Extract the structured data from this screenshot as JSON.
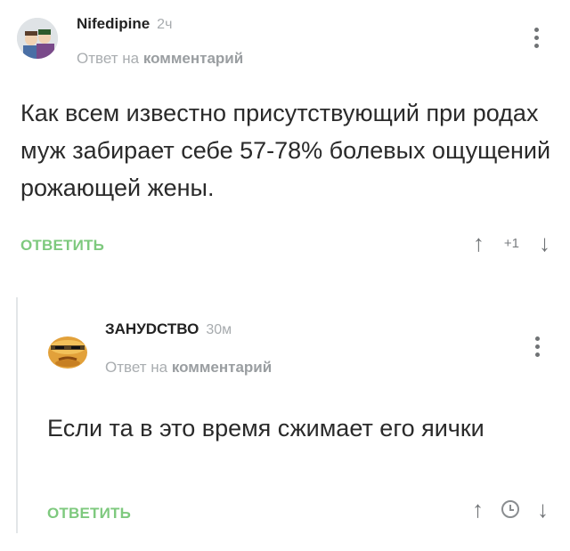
{
  "comments": [
    {
      "author": "Nifedipine",
      "time": "2ч",
      "reply_prefix": "Ответ на",
      "reply_target": "комментарий",
      "text": "Как всем известно присутствующий при родах муж забирает себе 57-78% болевых ощущений рожающей жены.",
      "reply_label": "ОТВЕТИТЬ",
      "score": "+1",
      "up_icon": "↑",
      "down_icon": "↓"
    },
    {
      "author": "ЗАНУDСТВО",
      "time": "30м",
      "reply_prefix": "Ответ на",
      "reply_target": "комментарий",
      "text": "Если та в это время сжимает его яички",
      "reply_label": "ОТВЕТИТЬ",
      "up_icon": "↑",
      "down_icon": "↓"
    }
  ],
  "colors": {
    "reply_green": "#7ec97e",
    "muted": "#a9adb0",
    "text": "#2a2a2a"
  }
}
